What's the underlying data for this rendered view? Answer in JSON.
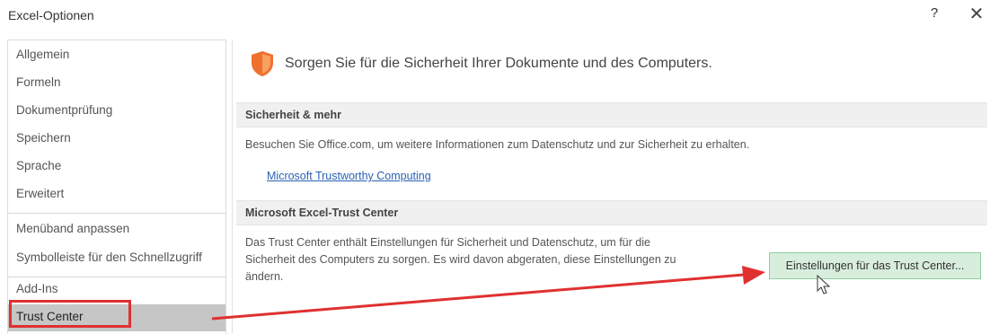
{
  "window": {
    "title": "Excel-Optionen",
    "help_label": "?",
    "close_label": "✕"
  },
  "sidebar": {
    "items": [
      {
        "label": "Allgemein"
      },
      {
        "label": "Formeln"
      },
      {
        "label": "Dokumentprüfung"
      },
      {
        "label": "Speichern"
      },
      {
        "label": "Sprache"
      },
      {
        "label": "Erweitert"
      },
      {
        "label": "Menüband anpassen"
      },
      {
        "label": "Symbolleiste für den Schnellzugriff"
      },
      {
        "label": "Add-Ins"
      },
      {
        "label": "Trust Center",
        "selected": true
      }
    ]
  },
  "main": {
    "heading": "Sorgen Sie für die Sicherheit Ihrer Dokumente und des Computers.",
    "heading_icon": "shield-icon",
    "section_security": {
      "title": "Sicherheit & mehr",
      "description": "Besuchen Sie Office.com, um weitere Informationen zum Datenschutz und zur Sicherheit zu erhalten.",
      "link": "Microsoft Trustworthy Computing"
    },
    "section_trust_center": {
      "title": "Microsoft Excel-Trust Center",
      "description_line1": "Das Trust Center enthält Einstellungen für Sicherheit und Datenschutz, um für die",
      "description_line2": "Sicherheit des Computers zu sorgen. Es wird davon abgeraten, diese Einstellungen zu",
      "description_line3": "ändern.",
      "button_label": "Einstellungen für das Trust Center..."
    }
  },
  "annotations": {
    "highlight_color": "#e03030",
    "arrow_color": "#e03030"
  },
  "colors": {
    "selected_item_bg": "#c6c6c6",
    "button_bg": "#d8eedd",
    "link": "#2a62b5",
    "shield": "#f07030"
  }
}
